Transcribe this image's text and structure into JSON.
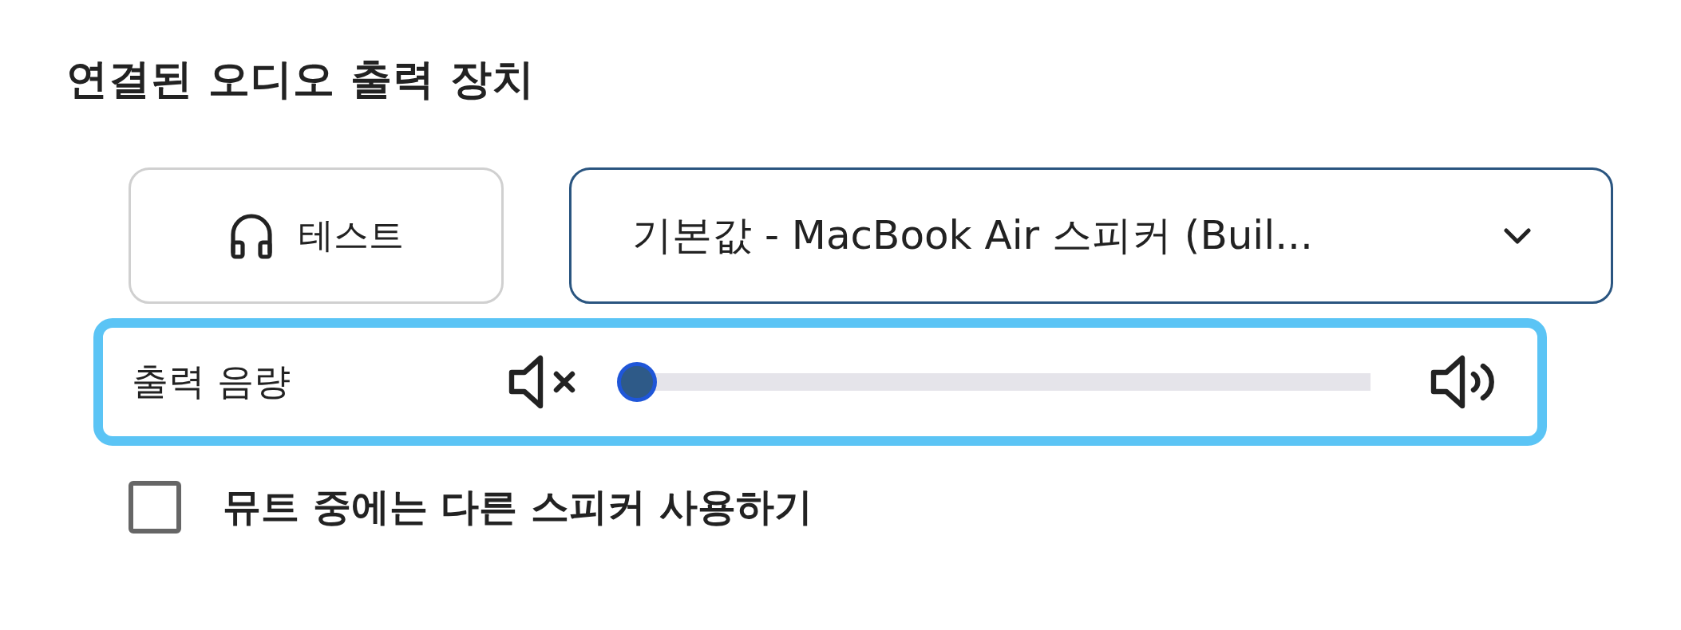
{
  "title": "연결된 오디오 출력 장치",
  "test_button": {
    "label": "테스트"
  },
  "device_select": {
    "value": "기본값 - MacBook Air 스피커 (Buil..."
  },
  "volume": {
    "label": "출력 음량",
    "level": 0,
    "focused": true
  },
  "mute_option": {
    "label": "뮤트 중에는 다른 스피커 사용하기",
    "checked": false
  }
}
